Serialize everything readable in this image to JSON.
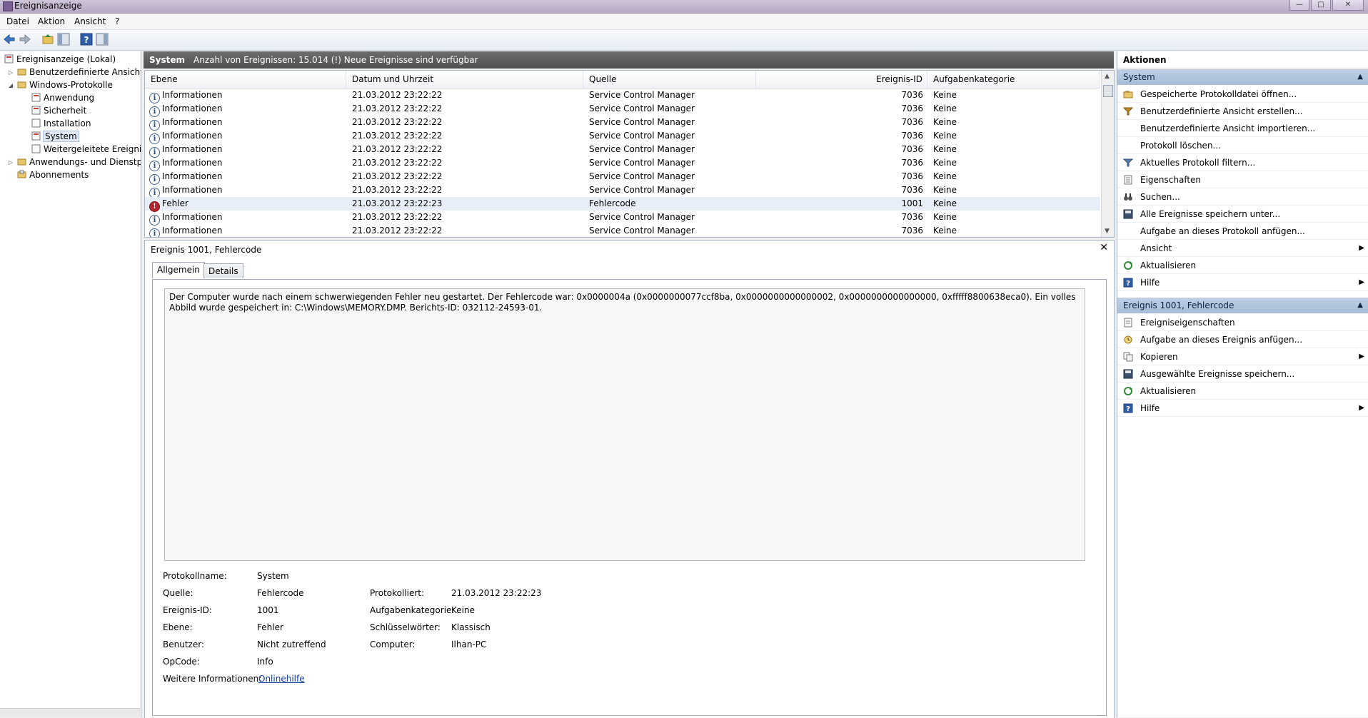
{
  "window": {
    "title": "Ereignisanzeige"
  },
  "menu": [
    "Datei",
    "Aktion",
    "Ansicht",
    "?"
  ],
  "tree": {
    "items": [
      {
        "label": "Ereignisanzeige (Lokal)",
        "level": 0
      },
      {
        "label": "Benutzerdefinierte Ansichten",
        "level": 1
      },
      {
        "label": "Windows-Protokolle",
        "level": 1
      },
      {
        "label": "Anwendung",
        "level": 2
      },
      {
        "label": "Sicherheit",
        "level": 2
      },
      {
        "label": "Installation",
        "level": 2
      },
      {
        "label": "System",
        "level": 2,
        "selected": true
      },
      {
        "label": "Weitergeleitete Ereignisse",
        "level": 2
      },
      {
        "label": "Anwendungs- und Dienstprotokolle",
        "level": 1
      },
      {
        "label": "Abonnements",
        "level": 1
      }
    ]
  },
  "center": {
    "log_name": "System",
    "count_text": "Anzahl von Ereignissen: 15.014 (!) Neue Ereignisse sind verfügbar"
  },
  "table": {
    "headers": [
      "Ebene",
      "Datum und Uhrzeit",
      "Quelle",
      "Ereignis-ID",
      "Aufgabenkategorie"
    ],
    "rows": [
      {
        "level": "Informationen",
        "datetime": "21.03.2012 23:22:22",
        "source": "Service Control Manager",
        "id": "7036",
        "category": "Keine",
        "type": "info"
      },
      {
        "level": "Informationen",
        "datetime": "21.03.2012 23:22:22",
        "source": "Service Control Manager",
        "id": "7036",
        "category": "Keine",
        "type": "info"
      },
      {
        "level": "Informationen",
        "datetime": "21.03.2012 23:22:22",
        "source": "Service Control Manager",
        "id": "7036",
        "category": "Keine",
        "type": "info"
      },
      {
        "level": "Informationen",
        "datetime": "21.03.2012 23:22:22",
        "source": "Service Control Manager",
        "id": "7036",
        "category": "Keine",
        "type": "info"
      },
      {
        "level": "Informationen",
        "datetime": "21.03.2012 23:22:22",
        "source": "Service Control Manager",
        "id": "7036",
        "category": "Keine",
        "type": "info"
      },
      {
        "level": "Informationen",
        "datetime": "21.03.2012 23:22:22",
        "source": "Service Control Manager",
        "id": "7036",
        "category": "Keine",
        "type": "info"
      },
      {
        "level": "Informationen",
        "datetime": "21.03.2012 23:22:22",
        "source": "Service Control Manager",
        "id": "7036",
        "category": "Keine",
        "type": "info"
      },
      {
        "level": "Informationen",
        "datetime": "21.03.2012 23:22:22",
        "source": "Service Control Manager",
        "id": "7036",
        "category": "Keine",
        "type": "info"
      },
      {
        "level": "Fehler",
        "datetime": "21.03.2012 23:22:23",
        "source": "Fehlercode",
        "id": "1001",
        "category": "Keine",
        "type": "error",
        "selected": true
      },
      {
        "level": "Informationen",
        "datetime": "21.03.2012 23:22:22",
        "source": "Service Control Manager",
        "id": "7036",
        "category": "Keine",
        "type": "info"
      },
      {
        "level": "Informationen",
        "datetime": "21.03.2012 23:22:22",
        "source": "Service Control Manager",
        "id": "7036",
        "category": "Keine",
        "type": "info"
      }
    ]
  },
  "detail": {
    "title": "Ereignis 1001, Fehlercode",
    "tabs": [
      "Allgemein",
      "Details"
    ],
    "description": "Der Computer wurde nach einem schwerwiegenden Fehler neu gestartet. Der Fehlercode war: 0x0000004a (0x0000000077ccf8ba, 0x0000000000000002, 0x0000000000000000, 0xfffff8800638eca0). Ein volles Abbild wurde gespeichert in: C:\\Windows\\MEMORY.DMP. Berichts-ID: 032112-24593-01.",
    "props": {
      "protokollname_label": "Protokollname:",
      "protokollname": "System",
      "quelle_label": "Quelle:",
      "quelle": "Fehlercode",
      "protokolliert_label": "Protokolliert:",
      "protokolliert": "21.03.2012 23:22:23",
      "ereignisid_label": "Ereignis-ID:",
      "ereignisid": "1001",
      "aufgabenkategorie_label": "Aufgabenkategorie:",
      "aufgabenkategorie": "Keine",
      "ebene_label": "Ebene:",
      "ebene": "Fehler",
      "schluesselwoerter_label": "Schlüsselwörter:",
      "schluesselwoerter": "Klassisch",
      "benutzer_label": "Benutzer:",
      "benutzer": "Nicht zutreffend",
      "computer_label": "Computer:",
      "computer": "Ilhan-PC",
      "opcode_label": "OpCode:",
      "opcode": "Info",
      "weitere_label": "Weitere Informationen:",
      "weitere_link": "Onlinehilfe"
    }
  },
  "actions": {
    "title": "Aktionen",
    "section1": {
      "title": "System",
      "items": [
        {
          "label": "Gespeicherte Protokolldatei öffnen...",
          "icon": "folder-open-icon"
        },
        {
          "label": "Benutzerdefinierte Ansicht erstellen...",
          "icon": "filter-create-icon"
        },
        {
          "label": "Benutzerdefinierte Ansicht importieren...",
          "icon": ""
        },
        {
          "label": "Protokoll löschen...",
          "icon": ""
        },
        {
          "label": "Aktuelles Protokoll filtern...",
          "icon": "filter-icon"
        },
        {
          "label": "Eigenschaften",
          "icon": "properties-icon"
        },
        {
          "label": "Suchen...",
          "icon": "binoculars-icon"
        },
        {
          "label": "Alle Ereignisse speichern unter...",
          "icon": "save-icon"
        },
        {
          "label": "Aufgabe an dieses Protokoll anfügen...",
          "icon": ""
        },
        {
          "label": "Ansicht",
          "icon": "",
          "submenu": true
        },
        {
          "label": "Aktualisieren",
          "icon": "refresh-icon"
        },
        {
          "label": "Hilfe",
          "icon": "help-icon",
          "submenu": true
        }
      ]
    },
    "section2": {
      "title": "Ereignis 1001, Fehlercode",
      "items": [
        {
          "label": "Ereigniseigenschaften",
          "icon": "event-properties-icon"
        },
        {
          "label": "Aufgabe an dieses Ereignis anfügen...",
          "icon": "task-icon"
        },
        {
          "label": "Kopieren",
          "icon": "copy-icon",
          "submenu": true
        },
        {
          "label": "Ausgewählte Ereignisse speichern...",
          "icon": "save-icon"
        },
        {
          "label": "Aktualisieren",
          "icon": "refresh-icon"
        },
        {
          "label": "Hilfe",
          "icon": "help-icon",
          "submenu": true
        }
      ]
    }
  }
}
